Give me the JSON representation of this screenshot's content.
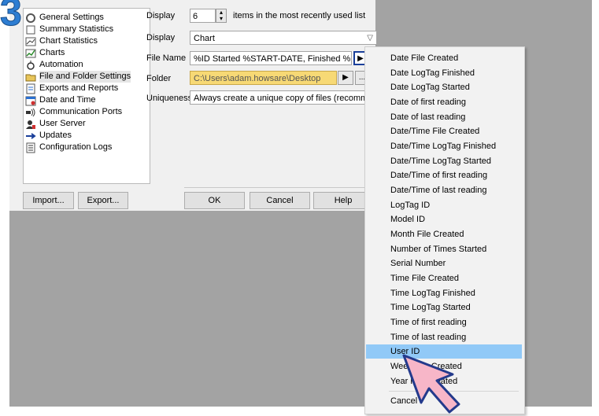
{
  "step_number": "3",
  "tree": {
    "items": [
      {
        "label": "General Settings",
        "icon": "settings-icon"
      },
      {
        "label": "Summary Statistics",
        "icon": "summary-icon"
      },
      {
        "label": "Chart Statistics",
        "icon": "chart-statistics-icon"
      },
      {
        "label": "Charts",
        "icon": "charts-icon"
      },
      {
        "label": "Automation",
        "icon": "automation-icon"
      },
      {
        "label": "File and Folder Settings",
        "icon": "folder-icon"
      },
      {
        "label": "Exports and Reports",
        "icon": "exports-icon"
      },
      {
        "label": "Date and Time",
        "icon": "calendar-icon"
      },
      {
        "label": "Communication Ports",
        "icon": "ports-icon"
      },
      {
        "label": "User Server",
        "icon": "user-server-icon"
      },
      {
        "label": "Updates",
        "icon": "arrow-right-icon"
      },
      {
        "label": "Configuration Logs",
        "icon": "log-icon"
      }
    ]
  },
  "form": {
    "display_label": "Display",
    "display_value": "6",
    "display_suffix": "items in the most recently used list",
    "display2_label": "Display",
    "display2_value": "Chart",
    "filename_label": "File Name",
    "filename_value": "%ID Started %START-DATE, Finished %FINISH-",
    "folder_label": "Folder",
    "folder_value": "C:\\Users\\adam.howsare\\Desktop",
    "folder_browse": "...",
    "uniqueness_label": "Uniqueness",
    "uniqueness_value": "Always create a unique copy of files (recommendec"
  },
  "buttons": {
    "import": "Import...",
    "export": "Export...",
    "ok": "OK",
    "cancel": "Cancel",
    "help": "Help"
  },
  "menu": {
    "items": [
      "Date File Created",
      "Date LogTag Finished",
      "Date LogTag Started",
      "Date of first reading",
      "Date of last reading",
      "Date/Time File Created",
      "Date/Time LogTag Finished",
      "Date/Time LogTag Started",
      "Date/Time of first reading",
      "Date/Time of last reading",
      "LogTag ID",
      "Model ID",
      "Month File Created",
      "Number of Times Started",
      "Serial Number",
      "Time File Created",
      "Time LogTag Finished",
      "Time LogTag Started",
      "Time of first reading",
      "Time of last reading",
      "User ID",
      "Week File Created",
      "Year File Created"
    ],
    "highlighted": "User ID",
    "cancel": "Cancel"
  },
  "colors": {
    "highlight": "#91c9f7",
    "folder_field": "#f7d975",
    "badge": "#2d7dd2",
    "cursor": "#f7b6c8"
  }
}
